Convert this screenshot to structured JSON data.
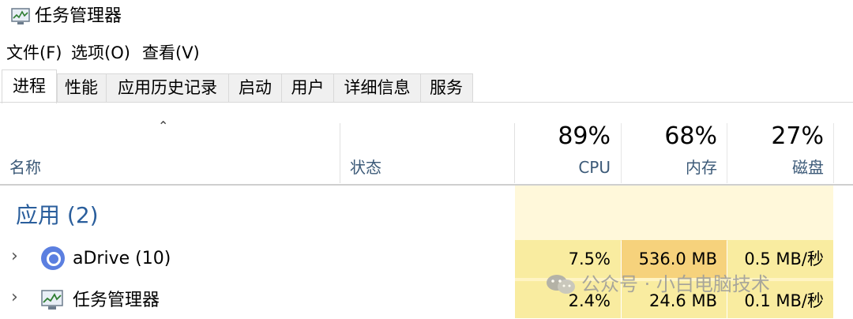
{
  "window": {
    "title": "任务管理器",
    "icon": "task-manager-icon"
  },
  "menu": [
    "文件(F)",
    "选项(O)",
    "查看(V)"
  ],
  "tabs": [
    "进程",
    "性能",
    "应用历史记录",
    "启动",
    "用户",
    "详细信息",
    "服务"
  ],
  "active_tab": "进程",
  "header": {
    "name_label": "名称",
    "status_label": "状态",
    "cpu": {
      "pct": "89%",
      "label": "CPU"
    },
    "memory": {
      "pct": "68%",
      "label": "内存"
    },
    "disk": {
      "pct": "27%",
      "label": "磁盘"
    }
  },
  "group": {
    "title": "应用 (2)"
  },
  "rows": [
    {
      "name": "aDrive (10)",
      "icon": "adrive-icon",
      "cpu": "7.5%",
      "memory": "536.0 MB",
      "disk": "0.5 MB/秒"
    },
    {
      "name": "任务管理器",
      "icon": "task-manager-icon",
      "cpu": "2.4%",
      "memory": "24.6 MB",
      "disk": "0.1 MB/秒"
    }
  ],
  "watermark": {
    "text": "公众号 · 小白电脑技术"
  },
  "colors": {
    "heat_light": "#fff4c4",
    "heat_medium": "#f9eca0",
    "heat_strong": "#f6d27c",
    "header_label": "#3c5a78",
    "group_title": "#2a5e9c"
  }
}
